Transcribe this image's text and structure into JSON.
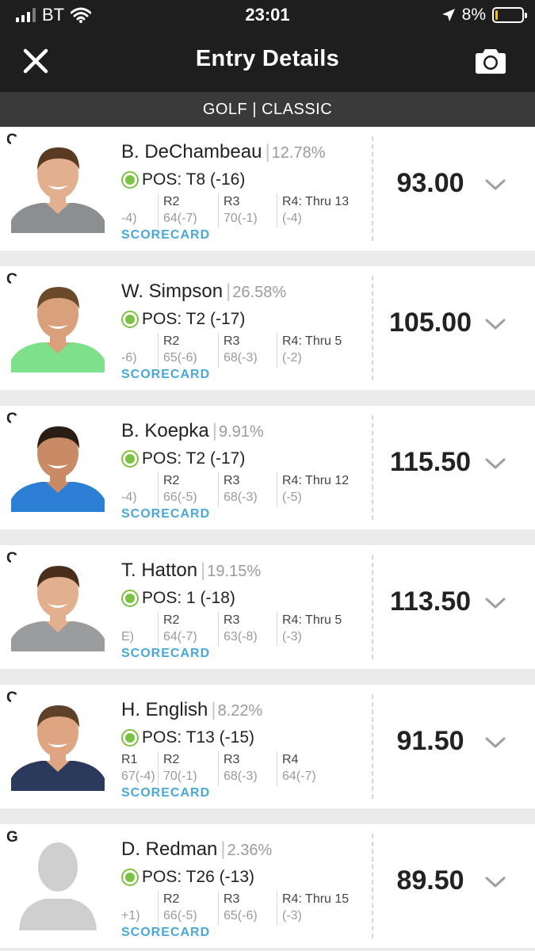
{
  "status_bar": {
    "carrier": "BT",
    "time": "23:01",
    "battery_percent": "8%",
    "battery_level": 0.08,
    "battery_color": "#f4c20d"
  },
  "header": {
    "title": "Entry Details",
    "close_icon": "close-icon",
    "camera_icon": "camera-icon"
  },
  "subheader": {
    "text": "GOLF | CLASSIC"
  },
  "players": [
    {
      "position": "G",
      "name": "B. DeChambeau",
      "ownership": "12.78%",
      "status": "POS: T8 (-16)",
      "points": "93.00",
      "scorecard_label": "SCORECARD",
      "rounds": [
        {
          "label": "",
          "score": "-4)"
        },
        {
          "label": "R2",
          "score": "64(-7)"
        },
        {
          "label": "R3",
          "score": "70(-1)"
        },
        {
          "label": "R4: Thru 13",
          "score": "(-4)"
        }
      ],
      "avatar": {
        "shirt": "#8c8f91",
        "skin": "#e2b08e",
        "hair": "#5a3a22",
        "photo": true
      }
    },
    {
      "position": "G",
      "name": "W. Simpson",
      "ownership": "26.58%",
      "status": "POS: T2 (-17)",
      "points": "105.00",
      "scorecard_label": "SCORECARD",
      "rounds": [
        {
          "label": "",
          "score": "-6)"
        },
        {
          "label": "R2",
          "score": "65(-6)"
        },
        {
          "label": "R3",
          "score": "68(-3)"
        },
        {
          "label": "R4: Thru 5",
          "score": "(-2)"
        }
      ],
      "avatar": {
        "shirt": "#7ee08a",
        "skin": "#d9a07b",
        "hair": "#6b4a2c",
        "photo": true
      }
    },
    {
      "position": "G",
      "name": "B. Koepka",
      "ownership": "9.91%",
      "status": "POS: T2 (-17)",
      "points": "115.50",
      "scorecard_label": "SCORECARD",
      "rounds": [
        {
          "label": "",
          "score": "-4)"
        },
        {
          "label": "R2",
          "score": "66(-5)"
        },
        {
          "label": "R3",
          "score": "68(-3)"
        },
        {
          "label": "R4: Thru 12",
          "score": "(-5)"
        }
      ],
      "avatar": {
        "shirt": "#2d7fd6",
        "skin": "#c98b65",
        "hair": "#2a1d14",
        "photo": true
      }
    },
    {
      "position": "G",
      "name": "T. Hatton",
      "ownership": "19.15%",
      "status": "POS: 1 (-18)",
      "points": "113.50",
      "scorecard_label": "SCORECARD",
      "rounds": [
        {
          "label": "",
          "score": "E)"
        },
        {
          "label": "R2",
          "score": "64(-7)"
        },
        {
          "label": "R3",
          "score": "63(-8)"
        },
        {
          "label": "R4: Thru 5",
          "score": "(-3)"
        }
      ],
      "avatar": {
        "shirt": "#9a9c9e",
        "skin": "#e2b08e",
        "hair": "#4a2e1c",
        "photo": true
      }
    },
    {
      "position": "G",
      "name": "H. English",
      "ownership": "8.22%",
      "status": "POS: T13 (-15)",
      "points": "91.50",
      "scorecard_label": "SCORECARD",
      "rounds": [
        {
          "label": "R1",
          "score": "67(-4)"
        },
        {
          "label": "R2",
          "score": "70(-1)"
        },
        {
          "label": "R3",
          "score": "68(-3)"
        },
        {
          "label": "R4",
          "score": "64(-7)"
        }
      ],
      "avatar": {
        "shirt": "#2b3a5c",
        "skin": "#dda582",
        "hair": "#5e4128",
        "photo": true
      }
    },
    {
      "position": "G",
      "name": "D. Redman",
      "ownership": "2.36%",
      "status": "POS: T26 (-13)",
      "points": "89.50",
      "scorecard_label": "SCORECARD",
      "rounds": [
        {
          "label": "",
          "score": "+1)"
        },
        {
          "label": "R2",
          "score": "66(-5)"
        },
        {
          "label": "R3",
          "score": "65(-6)"
        },
        {
          "label": "R4: Thru 15",
          "score": "(-3)"
        }
      ],
      "avatar": {
        "shirt": "#cfcfcf",
        "skin": "#cfcfcf",
        "hair": "#cfcfcf",
        "photo": false
      }
    }
  ]
}
